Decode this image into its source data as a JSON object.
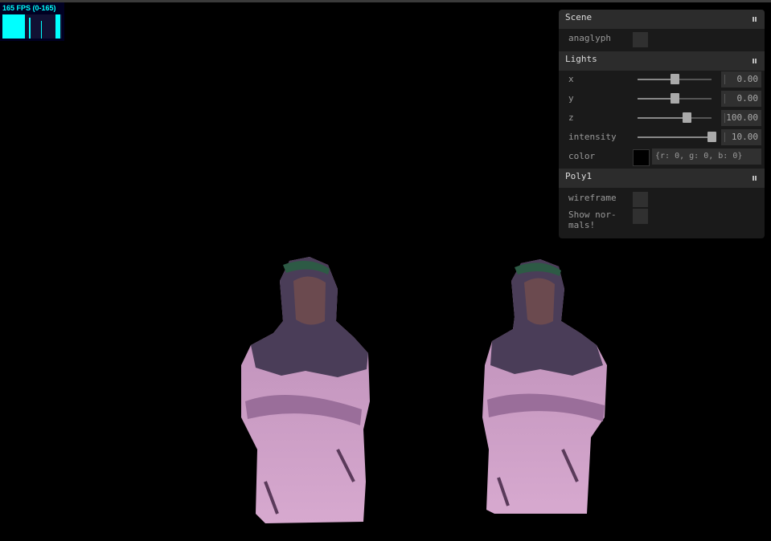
{
  "stats": {
    "fps_label": "165 FPS (0-165)",
    "fps": 165,
    "range": [
      0,
      165
    ],
    "graph_color": "#00ffff"
  },
  "gui": {
    "scene": {
      "title": "Scene",
      "anaglyph": {
        "label": "anaglyph",
        "checked": false
      }
    },
    "lights": {
      "title": "Lights",
      "controls": [
        {
          "label": "x",
          "value": "0.00",
          "fraction": 0.5
        },
        {
          "label": "y",
          "value": "0.00",
          "fraction": 0.5
        },
        {
          "label": "z",
          "value": "100.00",
          "fraction": 0.66
        },
        {
          "label": "intensity",
          "value": "10.00",
          "fraction": 1.0
        }
      ],
      "color": {
        "label": "color",
        "value": "{r: 0, g: 0, b: 0}",
        "swatch": "#000000"
      }
    },
    "poly1": {
      "title": "Poly1",
      "wireframe": {
        "label": "wireframe",
        "checked": false
      },
      "show_normals": {
        "label_line1": "Show nor-",
        "label_line2": "mals!",
        "checked": false
      }
    }
  },
  "scene_view": {
    "subject": "person-in-hoodie-point-cloud",
    "model_colors": {
      "hood": "#4a3a55",
      "body": "#c89ac0",
      "shadow": "#6a4a6a"
    }
  }
}
